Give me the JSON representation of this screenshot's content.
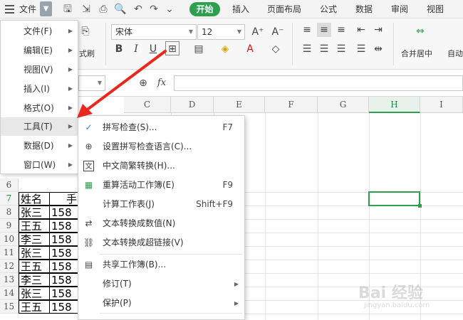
{
  "topbar": {
    "file_label": "文件",
    "tabs": [
      "开始",
      "插入",
      "页面布局",
      "公式",
      "数据",
      "审阅",
      "视图"
    ]
  },
  "ribbon": {
    "font_name": "宋体",
    "font_size": "12",
    "format_painter_label": "式刷",
    "merge_center_label": "合并居中",
    "auto_label": "自动"
  },
  "formula_bar": {
    "fx_label": "fx"
  },
  "grid": {
    "columns": [
      "C",
      "D",
      "E",
      "F",
      "G",
      "H",
      "I"
    ],
    "active_column": "H",
    "rows": [
      "6",
      "7",
      "8",
      "9",
      "10",
      "11",
      "12",
      "13",
      "14",
      "15"
    ],
    "table_header": [
      "姓名",
      "手"
    ],
    "table_rows": [
      [
        "张三",
        "158"
      ],
      [
        "王五",
        "158"
      ],
      [
        "李三",
        "158"
      ],
      [
        "张三",
        "158"
      ],
      [
        "王五",
        "158"
      ],
      [
        "李三",
        "158"
      ],
      [
        "张三",
        "158"
      ],
      [
        "王五",
        "158"
      ]
    ]
  },
  "file_menu": {
    "items": [
      "文件(F)",
      "编辑(E)",
      "视图(V)",
      "插入(I)",
      "格式(O)",
      "工具(T)",
      "数据(D)",
      "窗口(W)"
    ],
    "active_index": 5
  },
  "tools_menu": {
    "items": [
      {
        "label": "拼写检查(S)...",
        "shortcut": "F7",
        "submenu": false
      },
      {
        "label": "设置拼写检查语言(C)...",
        "shortcut": "",
        "submenu": false
      },
      {
        "label": "中文简繁转换(H)...",
        "shortcut": "",
        "submenu": false
      },
      {
        "label": "重算活动工作簿(E)",
        "shortcut": "F9",
        "submenu": false
      },
      {
        "label": "计算工作表(J)",
        "shortcut": "Shift+F9",
        "submenu": false
      },
      {
        "label": "文本转换成数值(N)",
        "shortcut": "",
        "submenu": false
      },
      {
        "label": "文本转换成超链接(V)",
        "shortcut": "",
        "submenu": false
      },
      {
        "label": "共享工作簿(B)...",
        "shortcut": "",
        "submenu": false
      },
      {
        "label": "修订(T)",
        "shortcut": "",
        "submenu": true
      },
      {
        "label": "保护(P)",
        "shortcut": "",
        "submenu": true
      }
    ]
  },
  "watermark": {
    "title": "Bai 经验",
    "sub": "jingyan.baidu.com"
  },
  "colors": {
    "accent_green": "#2e9e4f",
    "annotation_red": "#e8271f"
  }
}
